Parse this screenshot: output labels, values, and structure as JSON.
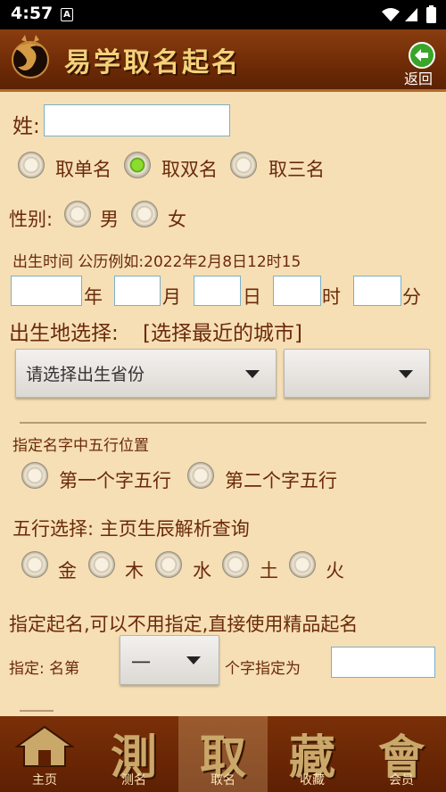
{
  "status": {
    "time": "4:57",
    "app_icon": "A"
  },
  "header": {
    "title": "易学取名起名",
    "back_label": "返回"
  },
  "surname": {
    "label": "姓:",
    "value": ""
  },
  "name_type": {
    "options": [
      "取单名",
      "取双名",
      "取三名"
    ],
    "selected": 1
  },
  "gender": {
    "label": "性别:",
    "options": [
      "男",
      "女"
    ]
  },
  "birth": {
    "label": "出生时间 公历例如:2022年2月8日12时15",
    "units": [
      "年",
      "月",
      "日",
      "时",
      "分"
    ]
  },
  "birthplace": {
    "label": "出生地选择:",
    "hint": "[选择最近的城市]",
    "province_placeholder": "请选择出生省份",
    "city_value": ""
  },
  "wuxing_position": {
    "label": "指定名字中五行位置",
    "options": [
      "第一个字五行",
      "第二个字五行"
    ]
  },
  "wuxing_select": {
    "label": "五行选择: 主页生辰解析查询",
    "options": [
      "金",
      "木",
      "水",
      "土",
      "火"
    ]
  },
  "designate": {
    "title": "指定起名,可以不用指定,直接使用精品起名",
    "prefix": "指定:  名第",
    "position_value": "一",
    "suffix": "个字指定为",
    "char_value": ""
  },
  "bottom_nav": [
    {
      "big": "",
      "label": "主页",
      "icon": "home-icon"
    },
    {
      "big": "測",
      "label": "测名"
    },
    {
      "big": "取",
      "label": "取名",
      "active": true
    },
    {
      "big": "藏",
      "label": "收藏"
    },
    {
      "big": "會",
      "label": "会员"
    }
  ],
  "colors": {
    "accent": "#6b2a0a",
    "background": "#f6dfb4",
    "nav": "#6e2b06",
    "checked": "#6cc21c"
  }
}
